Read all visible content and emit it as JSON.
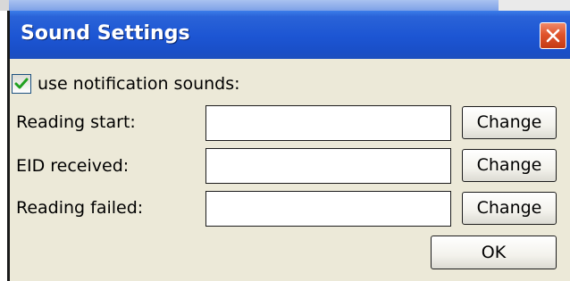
{
  "dialog": {
    "title": "Sound Settings"
  },
  "notifications": {
    "checkbox_label": "use notification sounds:",
    "checked": true
  },
  "rows": [
    {
      "label": "Reading start:",
      "value": "",
      "button_label": "Change"
    },
    {
      "label": "EID received:",
      "value": "",
      "button_label": "Change"
    },
    {
      "label": "Reading failed:",
      "value": "",
      "button_label": "Change"
    }
  ],
  "footer": {
    "ok_label": "OK"
  },
  "colors": {
    "titlebar": "#1c55d3",
    "close_button": "#e0542c",
    "dialog_background": "#ece9d8",
    "checkmark": "#21a121"
  }
}
